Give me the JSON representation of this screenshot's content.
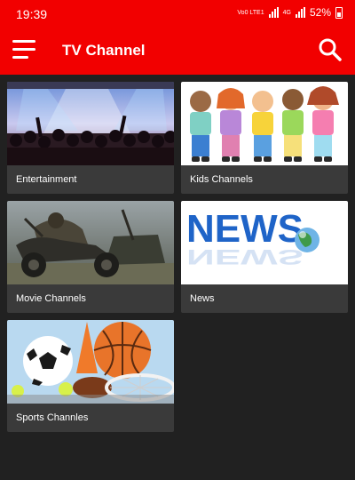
{
  "status": {
    "time": "19:39",
    "net_tag": "Vo0 LTE1",
    "net_type": "4G",
    "battery": "52%"
  },
  "app_bar": {
    "title": "TV Channel",
    "menu_icon": "hamburger-menu-icon",
    "search_icon": "search-icon"
  },
  "categories": [
    {
      "label": "Entertainment",
      "thumb": "concert-crowd-image"
    },
    {
      "label": "Kids Channels",
      "thumb": "cartoon-kids-image"
    },
    {
      "label": "Movie Channels",
      "thumb": "motorcycle-warrior-image"
    },
    {
      "label": "News",
      "thumb": "news-globe-image",
      "thumb_text": "NEWS"
    },
    {
      "label": "Sports Channles",
      "thumb": "sports-balls-image"
    }
  ],
  "colors": {
    "app_bar": "#f20000",
    "background": "#212121",
    "card": "#3a3a3a"
  }
}
